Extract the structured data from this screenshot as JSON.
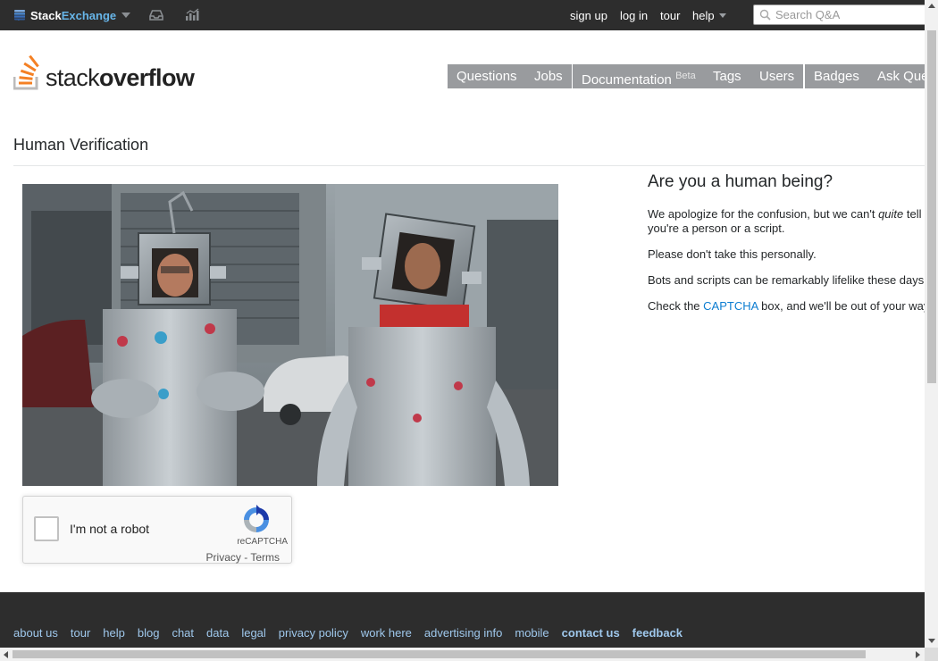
{
  "topbar": {
    "brand_part1": "Stack",
    "brand_part2": "Exchange",
    "inbox_icon": "inbox-icon",
    "achievements_icon": "achievements-icon",
    "links": {
      "sign_up": "sign up",
      "log_in": "log in",
      "tour": "tour",
      "help": "help"
    },
    "search_placeholder": "Search Q&A"
  },
  "header": {
    "logo_stack": "stack",
    "logo_overflow": "overflow",
    "nav": {
      "questions": "Questions",
      "jobs": "Jobs",
      "documentation": "Documentation",
      "documentation_badge": "Beta",
      "tags": "Tags",
      "users": "Users",
      "badges": "Badges",
      "ask": "Ask Question"
    }
  },
  "main": {
    "page_title": "Human Verification",
    "heading": "Are you a human being?",
    "p1_before": "We apologize for the confusion, but we can't ",
    "p1_em": "quite",
    "p1_after": " tell if you're a person or a script.",
    "p2": "Please don't take this personally.",
    "p3": "Bots and scripts can be remarkably lifelike these days!",
    "p4_before": "Check the ",
    "p4_link": "CAPTCHA",
    "p4_after": " box, and we'll be out of your way."
  },
  "recaptcha": {
    "label": "I'm not a robot",
    "brand": "reCAPTCHA",
    "privacy": "Privacy",
    "separator": " - ",
    "terms": "Terms"
  },
  "footer": {
    "links": [
      "about us",
      "tour",
      "help",
      "blog",
      "chat",
      "data",
      "legal",
      "privacy policy",
      "work here",
      "advertising info",
      "mobile"
    ],
    "bold_links": [
      "contact us",
      "feedback"
    ]
  },
  "colors": {
    "topbar_bg": "#2d2d2d",
    "nav_button_bg": "#999b9e",
    "link_blue": "#0c7dd1",
    "footer_link": "#9fc8ec",
    "brand_blue": "#67b5e8",
    "logo_orange": "#f48024"
  }
}
